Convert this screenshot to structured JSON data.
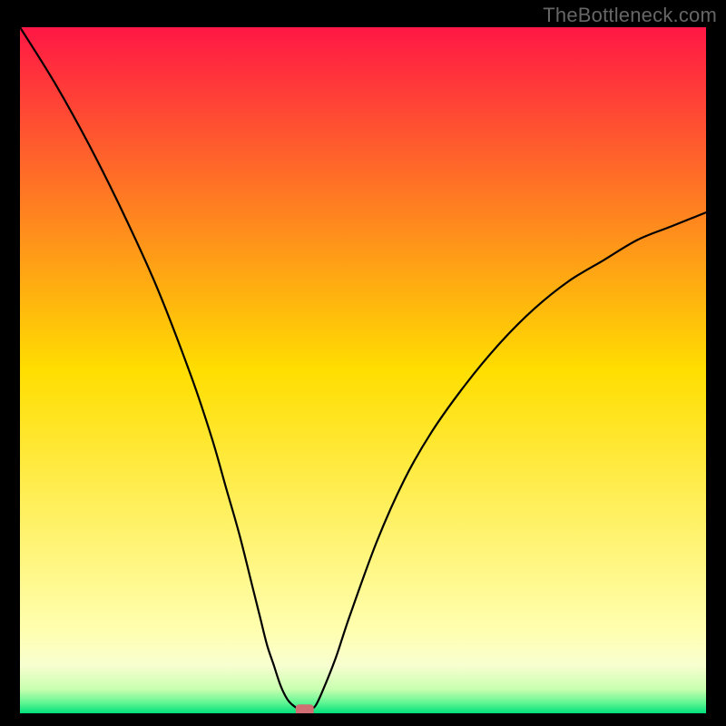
{
  "watermark": "TheBottleneck.com",
  "chart_data": {
    "type": "line",
    "title": "",
    "xlabel": "",
    "ylabel": "",
    "xlim": [
      0,
      100
    ],
    "ylim": [
      0,
      100
    ],
    "x": [
      0,
      5,
      10,
      15,
      20,
      25,
      28,
      30,
      32,
      34,
      35,
      36,
      37,
      38,
      39,
      40,
      41,
      42,
      43,
      44,
      46,
      48,
      52,
      56,
      60,
      65,
      70,
      75,
      80,
      85,
      90,
      95,
      100
    ],
    "y": [
      100,
      92,
      83,
      73,
      62,
      49,
      40,
      33,
      26,
      18,
      14,
      10,
      7,
      4,
      2,
      1,
      0.5,
      0.5,
      1,
      3,
      8,
      14,
      25,
      34,
      41,
      48,
      54,
      59,
      63,
      66,
      69,
      71,
      73
    ],
    "marker": {
      "x": 41.5,
      "y": 0.5,
      "color": "#cf6e73"
    },
    "background_gradient": {
      "stops": [
        {
          "offset": 0.0,
          "color": "#ff1745"
        },
        {
          "offset": 0.5,
          "color": "#ffde00"
        },
        {
          "offset": 0.88,
          "color": "#ffffb0"
        },
        {
          "offset": 0.93,
          "color": "#f8ffd0"
        },
        {
          "offset": 0.965,
          "color": "#c8ffb0"
        },
        {
          "offset": 0.985,
          "color": "#5ff593"
        },
        {
          "offset": 1.0,
          "color": "#00e07a"
        }
      ]
    }
  }
}
